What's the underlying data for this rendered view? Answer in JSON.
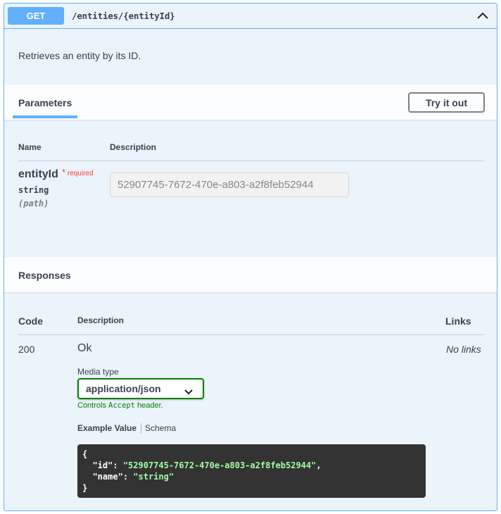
{
  "summary": {
    "method": "GET",
    "path": "/entities/{entityId}",
    "description": "Retrieves an entity by its ID."
  },
  "parameters": {
    "title": "Parameters",
    "try_button": "Try it out",
    "col_name": "Name",
    "col_description": "Description",
    "items": [
      {
        "name": "entityId",
        "required_marker": "*",
        "required_label": "required",
        "type": "string",
        "in": "(path)",
        "value": "52907745-7672-470e-a803-a2f8feb52944"
      }
    ]
  },
  "responses": {
    "title": "Responses",
    "col_code": "Code",
    "col_description": "Description",
    "col_links": "Links",
    "items": [
      {
        "code": "200",
        "description": "Ok",
        "links": "No links",
        "media_type_label": "Media type",
        "media_type": "application/json",
        "controls_note_prefix": "Controls ",
        "controls_note_code": "Accept",
        "controls_note_suffix": " header.",
        "tab_example": "Example Value",
        "tab_schema": "Schema",
        "example": {
          "open": "{",
          "id_key": "\"id\"",
          "id_value": "\"52907745-7672-470e-a803-a2f8feb52944\"",
          "name_key": "\"name\"",
          "name_value": "\"string\"",
          "close": "}"
        }
      }
    ]
  },
  "colors": {
    "get_blue": "#61affe",
    "panel_bg": "#ebf3fb",
    "required_red": "#f93e3e",
    "accept_green": "#008000",
    "code_bg": "#333333",
    "code_string": "#a2fca2"
  }
}
